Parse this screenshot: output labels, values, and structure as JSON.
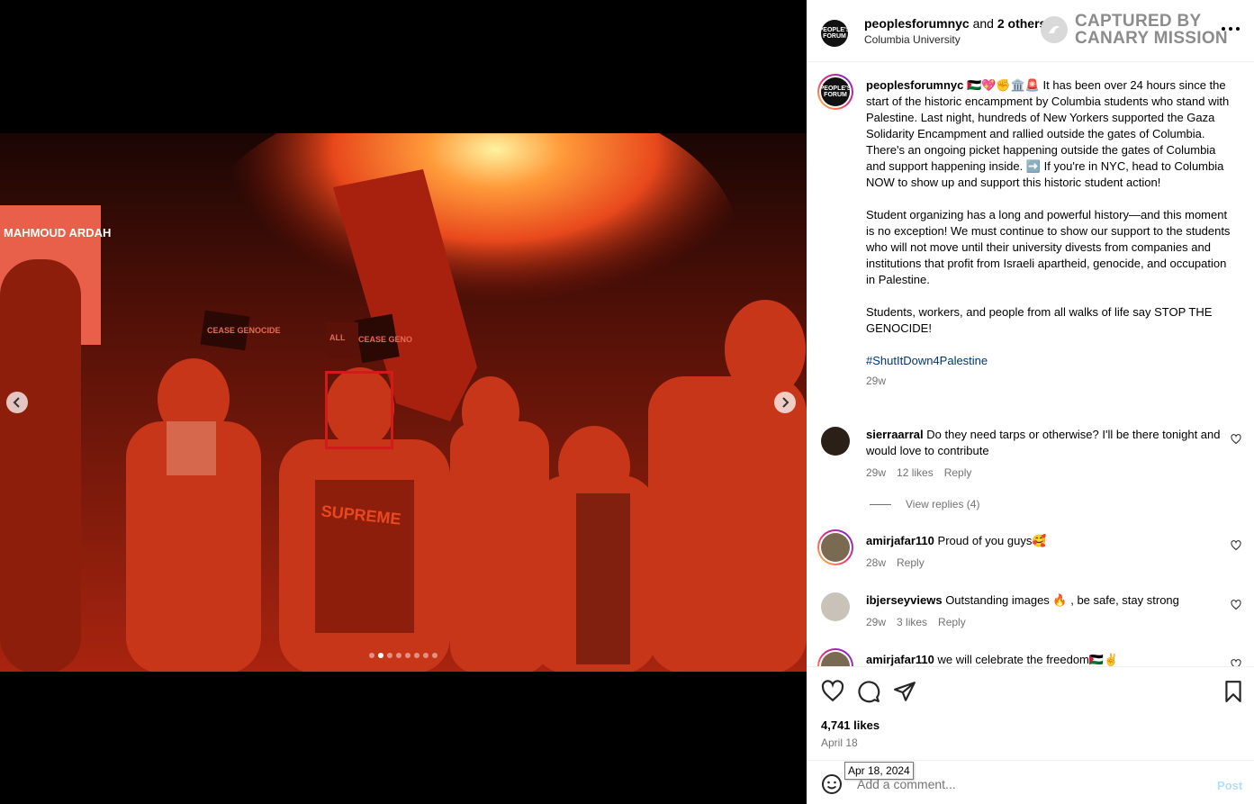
{
  "header": {
    "username": "peoplesforumnyc",
    "collab_text": "and",
    "others_text": "2 others",
    "location": "Columbia University",
    "watermark_line1": "CAPTURED BY",
    "watermark_line2": "CANARY MISSION",
    "avatar_text": "PEOPLE'S FORUM",
    "icons": [
      "more-options-icon",
      "canary-icon"
    ]
  },
  "media": {
    "carousel_dots": 8,
    "active_dot": 1,
    "sign_text_1": "MAHMOUD ARDAH",
    "sign_text_2": "CEASE GENOCIDE",
    "sign_text_3": "CEASE GENO",
    "sign_text_4": "ALL",
    "sweatshirt_text": "SUPREME",
    "colors": {
      "photo_glow": "#e8481c",
      "highlight": "#d11a1a"
    }
  },
  "caption": {
    "username": "peoplesforumnyc",
    "emoji": "🇵🇸💖✊🏛️🚨",
    "p1": "It has been over 24 hours since the start of the historic encampment by Columbia students who stand with Palestine. Last night, hundreds of New Yorkers supported the Gaza Solidarity Encampment and rallied outside the gates of Columbia. There's an ongoing picket happening outside the gates of Columbia and support happening inside. ➡️ If you're in NYC, head to Columbia NOW to show up and support this historic student action!",
    "p2": "Student organizing has a long and powerful history—and this moment is no exception! We must continue to show our support to the students who will not move until their university divests from companies and institutions that profit from Israeli apartheid, genocide, and occupation in Palestine.",
    "p3": "Students, workers, and people from all walks of life say STOP THE GENOCIDE!",
    "hashtag": "#ShutItDown4Palestine",
    "age": "29w"
  },
  "comments": [
    {
      "username": "sierraarral",
      "text": "Do they need tarps or otherwise? I'll be there tonight and would love to contribute",
      "age": "29w",
      "likes": "12 likes",
      "reply": "Reply"
    },
    {
      "username": "amirjafar110",
      "text": "Proud of you guys🥰",
      "age": "28w",
      "likes": "",
      "reply": "Reply"
    },
    {
      "username": "ibjerseyviews",
      "text": "Outstanding images 🔥 , be safe, stay strong",
      "age": "29w",
      "likes": "3 likes",
      "reply": "Reply"
    },
    {
      "username": "amirjafar110",
      "text": "we will celebrate the freedom🇵🇸✌️"
    }
  ],
  "view_replies": "View replies (4)",
  "actions": {
    "likes": "4,741 likes",
    "date": "April 18",
    "tooltip": "Apr 18, 2024",
    "icons": [
      "heart-icon",
      "comment-icon",
      "share-icon",
      "bookmark-icon"
    ]
  },
  "comment_box": {
    "placeholder": "Add a comment...",
    "post_label": "Post"
  }
}
